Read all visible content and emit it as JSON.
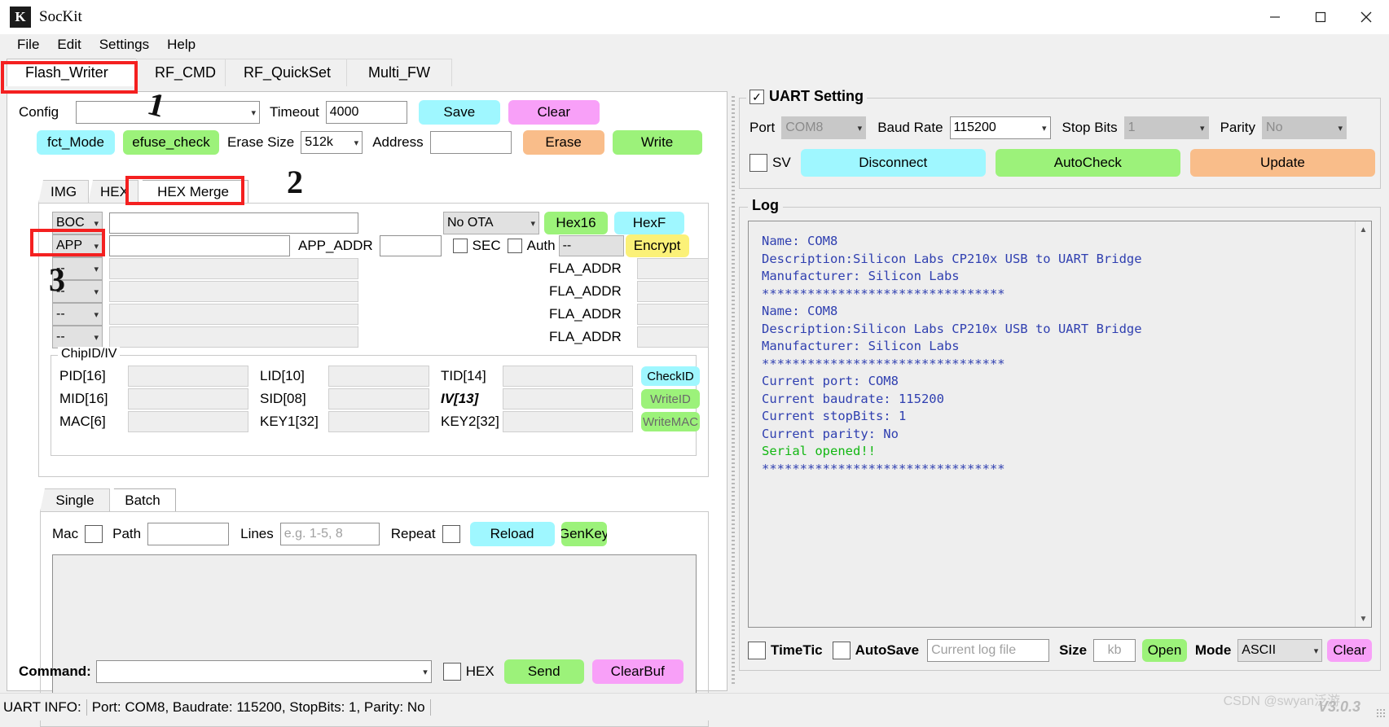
{
  "window": {
    "logo": "K",
    "title": "SocKit",
    "minimize": "─",
    "maximize": "☐",
    "close": "✕"
  },
  "menu": [
    "File",
    "Edit",
    "Settings",
    "Help"
  ],
  "tabs": [
    {
      "label": "Flash_Writer",
      "active": true
    },
    {
      "label": "RF_CMD",
      "active": false
    },
    {
      "label": "RF_QuickSet",
      "active": false
    },
    {
      "label": "Multi_FW",
      "active": false
    }
  ],
  "config_row": {
    "config_label": "Config",
    "config_value": "",
    "timeout_label": "Timeout",
    "timeout_value": "4000",
    "save_label": "Save",
    "clear_label": "Clear"
  },
  "erase_row": {
    "fct_mode_label": "fct_Mode",
    "efuse_check_label": "efuse_check",
    "erase_size_label": "Erase Size",
    "erase_size_value": "512k",
    "address_label": "Address",
    "address_value": "",
    "erase_label": "Erase",
    "write_label": "Write"
  },
  "inner_tabs": [
    {
      "label": "IMG",
      "active": false
    },
    {
      "label": "HEX",
      "active": false
    },
    {
      "label": "HEX Merge",
      "active": true
    }
  ],
  "merge_rows": [
    {
      "type": "BOC",
      "path": "",
      "disabled": false,
      "fla_label": "",
      "fla_value": ""
    },
    {
      "type": "APP",
      "path": "",
      "disabled": false,
      "fla_label": "",
      "fla_value": ""
    },
    {
      "type": "--",
      "path": "",
      "disabled": true,
      "fla_label": "FLA_ADDR",
      "fla_value": ""
    },
    {
      "type": "--",
      "path": "",
      "disabled": true,
      "fla_label": "FLA_ADDR",
      "fla_value": ""
    },
    {
      "type": "--",
      "path": "",
      "disabled": true,
      "fla_label": "FLA_ADDR",
      "fla_value": ""
    },
    {
      "type": "--",
      "path": "",
      "disabled": true,
      "fla_label": "FLA_ADDR",
      "fla_value": ""
    }
  ],
  "ota_row": {
    "ota_value": "No OTA",
    "hex16_label": "Hex16",
    "hexf_label": "HexF"
  },
  "app_row": {
    "app_addr_label": "APP_ADDR",
    "app_addr_value": "",
    "sec_label": "SEC",
    "auth_label": "Auth",
    "auth_value": "--",
    "encrypt_label": "Encrypt"
  },
  "chipid": {
    "title": "ChipID/IV",
    "fields": [
      {
        "label": "PID[16]",
        "value": ""
      },
      {
        "label": "LID[10]",
        "value": ""
      },
      {
        "label": "TID[14]",
        "value": ""
      },
      {
        "label": "MID[16]",
        "value": ""
      },
      {
        "label": "SID[08]",
        "value": ""
      },
      {
        "label": "IV[13]",
        "value": ""
      },
      {
        "label": "MAC[6]",
        "value": ""
      },
      {
        "label": "KEY1[32]",
        "value": ""
      },
      {
        "label": "KEY2[32]",
        "value": ""
      }
    ],
    "buttons": [
      {
        "label": "CheckID",
        "color": "cyan"
      },
      {
        "label": "WriteID",
        "color": "green"
      },
      {
        "label": "WriteMAC",
        "color": "green"
      }
    ]
  },
  "batch_tabs": [
    {
      "label": "Single",
      "active": false
    },
    {
      "label": "Batch",
      "active": true
    }
  ],
  "batch": {
    "mac_label": "Mac",
    "path_label": "Path",
    "path_value": "",
    "lines_label": "Lines",
    "lines_placeholder": "e.g. 1-5, 8",
    "repeat_label": "Repeat",
    "reload_label": "Reload",
    "genkey_label": "GenKey",
    "list_value": ""
  },
  "command_bar": {
    "label": "Command:",
    "value": "",
    "hex_label": "HEX",
    "send_label": "Send",
    "clearbuf_label": "ClearBuf"
  },
  "uart": {
    "group_title": "UART Setting",
    "port_label": "Port",
    "port_value": "COM8",
    "baud_label": "Baud Rate",
    "baud_value": "115200",
    "stopbits_label": "Stop Bits",
    "stopbits_value": "1",
    "parity_label": "Parity",
    "parity_value": "No",
    "sv_label": "SV",
    "disconnect_label": "Disconnect",
    "autocheck_label": "AutoCheck",
    "update_label": "Update"
  },
  "log": {
    "title": "Log",
    "lines": [
      {
        "text": "Name: COM8",
        "color": "blue"
      },
      {
        "text": "Description:Silicon Labs CP210x USB to UART Bridge",
        "color": "blue"
      },
      {
        "text": "Manufacturer: Silicon Labs",
        "color": "blue"
      },
      {
        "text": "********************************",
        "color": "blue"
      },
      {
        "text": "Name: COM8",
        "color": "blue"
      },
      {
        "text": "Description:Silicon Labs CP210x USB to UART Bridge",
        "color": "blue"
      },
      {
        "text": "Manufacturer: Silicon Labs",
        "color": "blue"
      },
      {
        "text": "********************************",
        "color": "blue"
      },
      {
        "text": "Current port: COM8",
        "color": "blue"
      },
      {
        "text": "Current baudrate: 115200",
        "color": "blue"
      },
      {
        "text": "Current stopBits: 1",
        "color": "blue"
      },
      {
        "text": "Current parity: No",
        "color": "blue"
      },
      {
        "text": "Serial opened!!",
        "color": "green"
      },
      {
        "text": "********************************",
        "color": "blue"
      }
    ],
    "toolbar": {
      "timetic_label": "TimeTic",
      "autosave_label": "AutoSave",
      "logfile_placeholder": "Current log file",
      "size_label": "Size",
      "size_placeholder": "kb",
      "open_label": "Open",
      "mode_label": "Mode",
      "mode_value": "ASCII",
      "clear_label": "Clear"
    }
  },
  "statusbar": {
    "prefix": "UART INFO:",
    "info": "Port: COM8, Baudrate: 115200, StopBits: 1, Parity: No"
  },
  "overlay": {
    "mark1": "1",
    "mark2": "2",
    "mark3": "3",
    "watermark": "CSDN @swyan泛游",
    "version": "V3.0.3"
  },
  "colors": {
    "cyan": "#9ff7ff",
    "magenta": "#f8a0f8",
    "green": "#9cf27a",
    "orange": "#f9bd8a",
    "yellow": "#fbf178",
    "annotation_red": "#f42020",
    "log_blue": "#2f3fb0",
    "log_green": "#12b712"
  }
}
